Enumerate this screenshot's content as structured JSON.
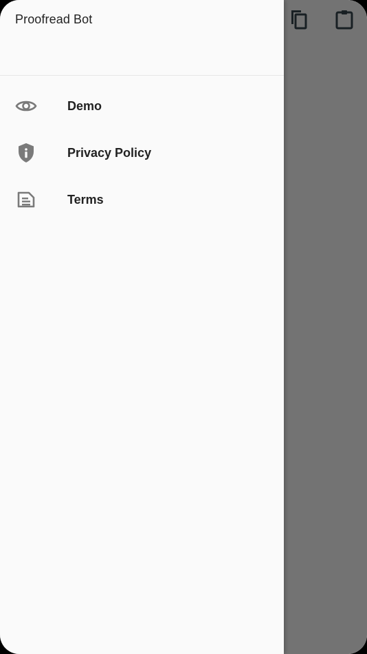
{
  "drawer": {
    "title": "Proofread Bot",
    "items": [
      {
        "label": "Demo",
        "icon": "eye-icon"
      },
      {
        "label": "Privacy Policy",
        "icon": "shield-info-icon"
      },
      {
        "label": "Terms",
        "icon": "document-icon"
      }
    ]
  },
  "app_bar": {
    "actions": [
      {
        "icon": "copy-icon"
      },
      {
        "icon": "paste-icon"
      }
    ]
  },
  "colors": {
    "icon_gray": "#7a7a7a",
    "text": "#222222",
    "scrim": "#6f6f6f",
    "drawer_bg": "#fafafa"
  }
}
